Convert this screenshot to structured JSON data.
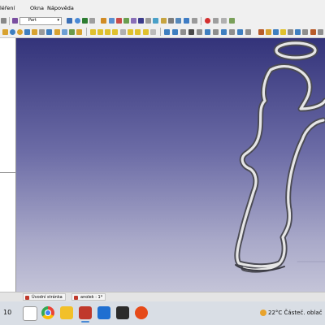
{
  "menu": {
    "items": [
      "léření",
      "Okna",
      "Nápověda"
    ]
  },
  "toolbar": {
    "workbench_combo": "Part"
  },
  "tabs": [
    {
      "label": "Úvodní stránka"
    },
    {
      "label": "anolek : 1*"
    }
  ],
  "taskbar": {
    "time": "10",
    "weather": {
      "temperature": "22°C",
      "condition": "Částeč. oblač"
    }
  },
  "colors": {
    "viewport_top": "#33337a",
    "viewport_bottom": "#c4c4d8",
    "model_outline": "#e6e6e6"
  }
}
